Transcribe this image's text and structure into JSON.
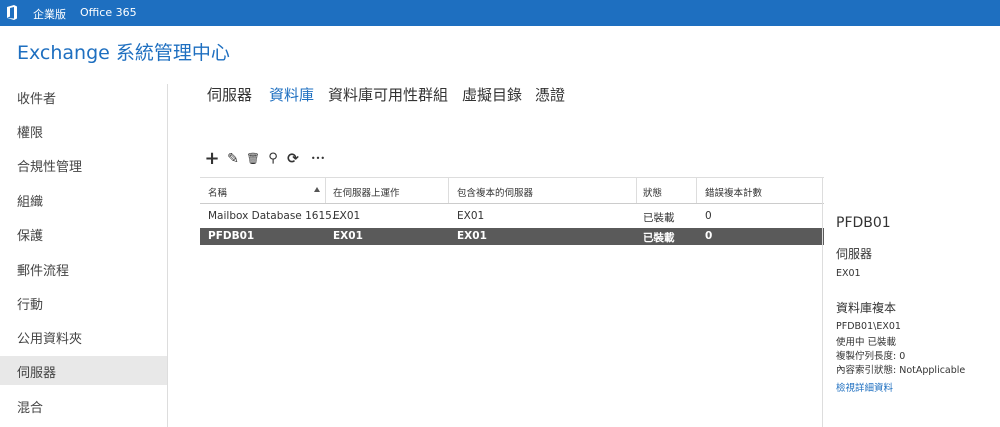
{
  "topbar": {
    "product": "企業版",
    "suite": "Office 365"
  },
  "app_title": "Exchange 系統管理中心",
  "sidebar": {
    "items": [
      {
        "label": "收件者"
      },
      {
        "label": "權限"
      },
      {
        "label": "合規性管理"
      },
      {
        "label": "組織"
      },
      {
        "label": "保護"
      },
      {
        "label": "郵件流程"
      },
      {
        "label": "行動"
      },
      {
        "label": "公用資料夾"
      },
      {
        "label": "伺服器",
        "active": true
      },
      {
        "label": "混合"
      }
    ]
  },
  "tabs": [
    {
      "label": "伺服器"
    },
    {
      "label": "資料庫",
      "active": true
    },
    {
      "label": "資料庫可用性群組"
    },
    {
      "label": "虛擬目錄"
    },
    {
      "label": "憑證"
    }
  ],
  "toolbar": {
    "add": "+",
    "edit": "✎",
    "delete": "🗑",
    "search": "⚲",
    "refresh": "⟳",
    "more": "•••"
  },
  "grid": {
    "headers": [
      "名稱",
      "在伺服器上運作",
      "包含複本的伺服器",
      "狀態",
      "錯誤複本計數"
    ],
    "rows": [
      [
        "Mailbox Database 1615...",
        "EX01",
        "EX01",
        "已裝載",
        "0"
      ],
      [
        "PFDB01",
        "EX01",
        "EX01",
        "已裝載",
        "0"
      ]
    ]
  },
  "detail": {
    "title": "PFDB01",
    "server_heading": "伺服器",
    "server_value": "EX01",
    "copies_heading": "資料庫複本",
    "copy_name": "PFDB01\\EX01",
    "copy_status": "使用中 已裝載",
    "copy_queue": "複製佇列長度: 0",
    "index_status": "內容索引狀態: NotApplicable",
    "view_details": "檢視詳細資料"
  },
  "colors": {
    "accent": "#1e6fc0",
    "selected_row": "#5a5a5a"
  }
}
